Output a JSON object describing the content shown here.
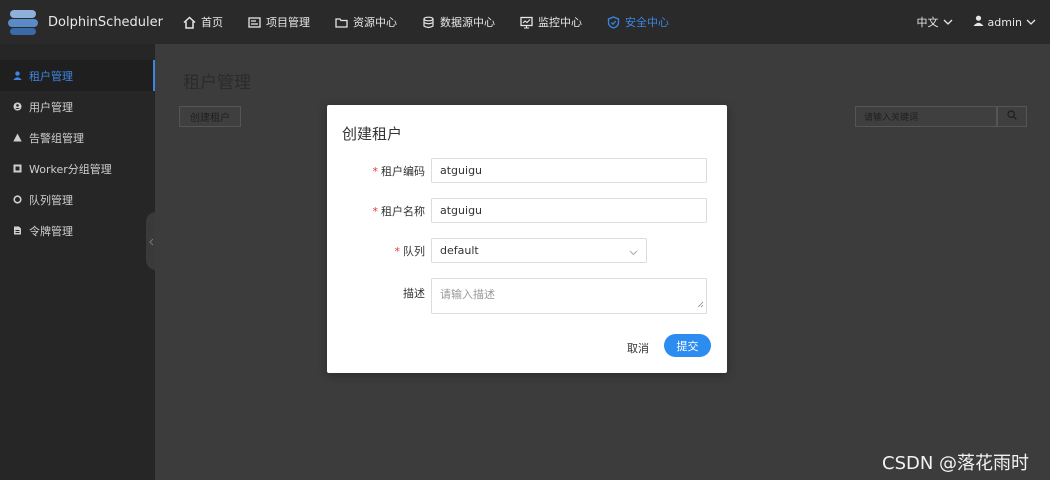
{
  "app": {
    "logo_text": "DolphinScheduler"
  },
  "nav": {
    "items": [
      {
        "label": "首页",
        "icon": "home-icon"
      },
      {
        "label": "项目管理",
        "icon": "project-icon"
      },
      {
        "label": "资源中心",
        "icon": "folder-icon"
      },
      {
        "label": "数据源中心",
        "icon": "database-icon"
      },
      {
        "label": "监控中心",
        "icon": "monitor-icon"
      },
      {
        "label": "安全中心",
        "icon": "shield-icon"
      }
    ],
    "active_index": 5,
    "language": "中文",
    "user": "admin"
  },
  "sidebar": {
    "items": [
      {
        "label": "租户管理",
        "icon": "user-icon"
      },
      {
        "label": "用户管理",
        "icon": "account-icon"
      },
      {
        "label": "告警组管理",
        "icon": "alert-icon"
      },
      {
        "label": "Worker分组管理",
        "icon": "worker-icon"
      },
      {
        "label": "队列管理",
        "icon": "queue-icon"
      },
      {
        "label": "令牌管理",
        "icon": "token-icon"
      }
    ],
    "active_index": 0
  },
  "main": {
    "title": "租户管理",
    "create_button": "创建租户",
    "search_placeholder": "请输入关键词"
  },
  "modal": {
    "title": "创建租户",
    "fields": {
      "tenant_code": {
        "label": "租户编码",
        "value": "atguigu",
        "required": true
      },
      "tenant_name": {
        "label": "租户名称",
        "value": "atguigu",
        "required": true
      },
      "queue": {
        "label": "队列",
        "value": "default",
        "required": true
      },
      "description": {
        "label": "描述",
        "placeholder": "请输入描述",
        "required": false
      }
    },
    "cancel_label": "取消",
    "submit_label": "提交"
  },
  "watermark": "CSDN @落花雨时",
  "colors": {
    "accent": "#2d8cf0",
    "nav_active": "#3b86e3",
    "required": "#e33333"
  }
}
